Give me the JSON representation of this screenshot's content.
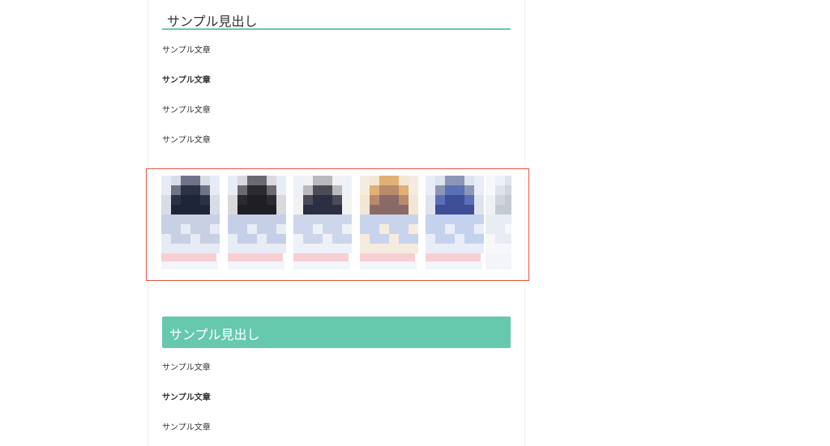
{
  "article": {
    "heading1": "サンプル見出し",
    "paragraphs1": [
      "サンプル文章",
      "サンプル文章",
      "サンプル文章",
      "サンプル文章"
    ],
    "heading2": "サンプル見出し",
    "paragraphs2": [
      "サンプル文章",
      "サンプル文章",
      "サンプル文章"
    ]
  },
  "colors": {
    "accent_green": "#66c9ae",
    "highlight_border": "#e2553e"
  },
  "product_carousel": {
    "item_count": 6,
    "note": "pixelated product thumbnails"
  }
}
